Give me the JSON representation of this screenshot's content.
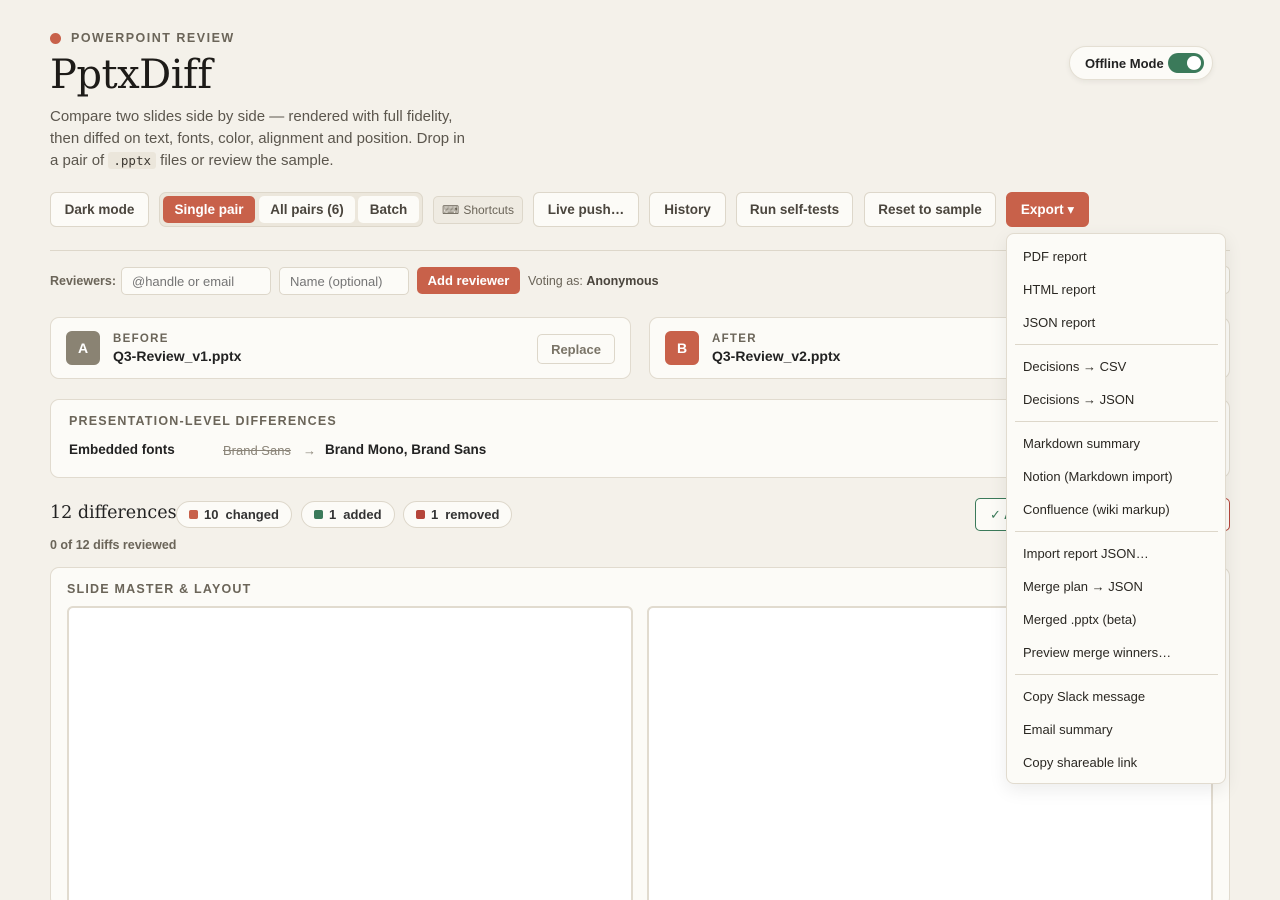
{
  "header": {
    "eyebrow": "POWERPOINT REVIEW",
    "title": "PptxDiff",
    "subtitle_before": "Compare two slides side by side — rendered with full fidelity, then diffed on text, fonts, color, alignment and position. Drop in a pair of ",
    "subtitle_code": ".pptx",
    "subtitle_after": " files or review the sample.",
    "offline_label": "Offline Mode"
  },
  "toolbar": {
    "dark_mode": "Dark mode",
    "single_pair": "Single pair",
    "all_pairs": "All pairs (6)",
    "batch": "Batch",
    "shortcuts": "Shortcuts",
    "shortcuts_glyph": "⌨",
    "live_push": "Live push…",
    "history": "History",
    "self_tests": "Run self-tests",
    "reset": "Reset to sample",
    "export": "Export ▾"
  },
  "reviewers": {
    "label": "Reviewers:",
    "handle_placeholder": "@handle or email",
    "name_placeholder": "Name (optional)",
    "add_button": "Add reviewer",
    "voting_prefix": "Voting as: ",
    "voting_name": "Anonymous"
  },
  "files": {
    "before": {
      "badge": "A",
      "label": "BEFORE",
      "name": "Q3-Review_v1.pptx",
      "action": "Replace"
    },
    "after": {
      "badge": "B",
      "label": "AFTER",
      "name": "Q3-Review_v2.pptx"
    }
  },
  "presentation_diffs": {
    "heading": "PRESENTATION-LEVEL DIFFERENCES",
    "rows": [
      {
        "key": "Embedded fonts",
        "old": "Brand Sans",
        "arrow": "→",
        "new": "Brand Mono, Brand Sans"
      }
    ]
  },
  "summary": {
    "count_text": "12 differences",
    "changed_count": "10",
    "changed_label": "changed",
    "added_count": "1",
    "added_label": "added",
    "removed_count": "1",
    "removed_label": "removed",
    "reviewed_text": "0 of 12 diffs reviewed",
    "accept_partial": "✓ A"
  },
  "section": {
    "slide_master": "SLIDE MASTER & LAYOUT"
  },
  "export_menu": {
    "items": [
      "PDF report",
      "HTML report",
      "JSON report",
      "Decisions → CSV",
      "Decisions → JSON",
      "Markdown summary",
      "Notion (Markdown import)",
      "Confluence (wiki markup)",
      "Import report JSON…",
      "Merge plan → JSON",
      "Merged .pptx (beta)",
      "Preview merge winners…",
      "Copy Slack message",
      "Email summary",
      "Copy shareable link"
    ]
  },
  "colors": {
    "accent": "#c8614a",
    "changed": "#c8614a",
    "added": "#3b7a5a",
    "removed": "#b5453a",
    "badge_before": "#8a8373",
    "badge_after": "#c8614a"
  }
}
